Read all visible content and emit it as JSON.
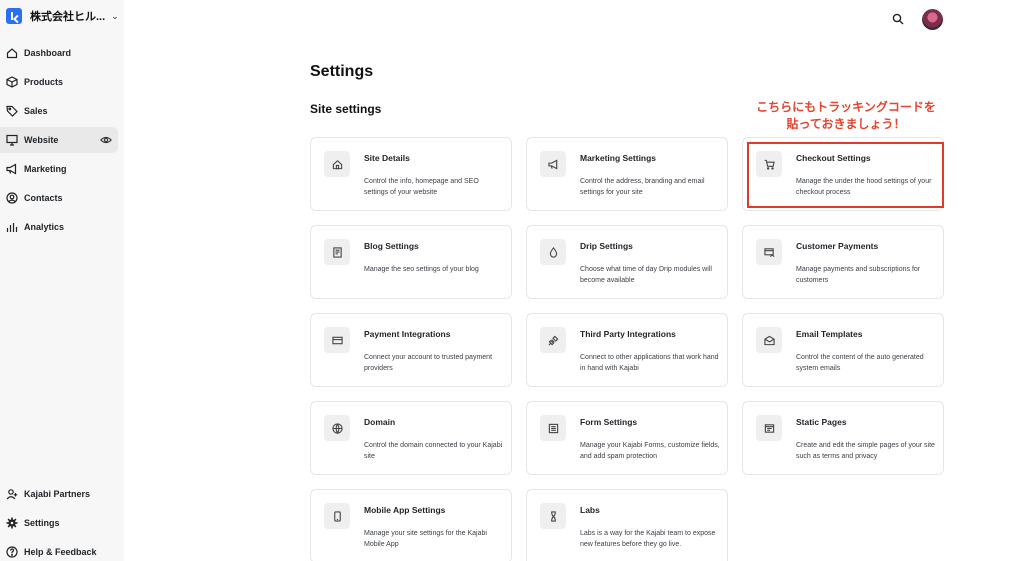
{
  "brand": {
    "name": "株式会社ヒル...",
    "chevron": "⌄"
  },
  "sidebar": {
    "items": [
      {
        "label": "Dashboard",
        "icon": "home-icon"
      },
      {
        "label": "Products",
        "icon": "box-icon"
      },
      {
        "label": "Sales",
        "icon": "tag-icon"
      },
      {
        "label": "Website",
        "icon": "monitor-icon",
        "active": true
      },
      {
        "label": "Marketing",
        "icon": "megaphone-icon"
      },
      {
        "label": "Contacts",
        "icon": "user-circle-icon"
      },
      {
        "label": "Analytics",
        "icon": "bar-chart-icon"
      }
    ],
    "bottom_items": [
      {
        "label": "Kajabi Partners",
        "icon": "user-plus-icon"
      },
      {
        "label": "Settings",
        "icon": "gear-icon"
      },
      {
        "label": "Help & Feedback",
        "icon": "help-icon"
      }
    ]
  },
  "page": {
    "title": "Settings",
    "section_title": "Site settings"
  },
  "annotation": {
    "line1": "こちらにもトラッキングコードを",
    "line2": "貼っておきましょう！",
    "color": "#e5442f"
  },
  "cards": [
    {
      "title": "Site Details",
      "desc": "Control the info, homepage and SEO settings of your website",
      "icon": "home-icon"
    },
    {
      "title": "Marketing Settings",
      "desc": "Control the address, branding and email settings for your site",
      "icon": "megaphone-icon"
    },
    {
      "title": "Checkout Settings",
      "desc": "Manage the under the hood settings of your checkout process",
      "icon": "cart-icon"
    },
    {
      "title": "Blog Settings",
      "desc": "Manage the seo settings of your blog",
      "icon": "blog-icon"
    },
    {
      "title": "Drip Settings",
      "desc": "Choose what time of day Drip modules will become available",
      "icon": "drop-icon"
    },
    {
      "title": "Customer Payments",
      "desc": "Manage payments and subscriptions for customers",
      "icon": "payment-icon"
    },
    {
      "title": "Payment Integrations",
      "desc": "Connect your account to trusted payment providers",
      "icon": "card-icon"
    },
    {
      "title": "Third Party Integrations",
      "desc": "Connect to other applications that work hand in hand with Kajabi",
      "icon": "plug-icon"
    },
    {
      "title": "Email Templates",
      "desc": "Control the content of the auto generated system emails",
      "icon": "mail-icon"
    },
    {
      "title": "Domain",
      "desc": "Control the domain connected to your Kajabi site",
      "icon": "globe-icon"
    },
    {
      "title": "Form Settings",
      "desc": "Manage your Kajabi Forms, customize fields, and add spam protection",
      "icon": "form-icon"
    },
    {
      "title": "Static Pages",
      "desc": "Create and edit the simple pages of your site such as terms and privacy",
      "icon": "page-icon"
    },
    {
      "title": "Mobile App Settings",
      "desc": "Manage your site settings for the Kajabi Mobile App",
      "icon": "mobile-icon"
    },
    {
      "title": "Labs",
      "desc": "Labs is a way for the Kajabi team to expose new features before they go live.",
      "icon": "flask-icon"
    }
  ]
}
